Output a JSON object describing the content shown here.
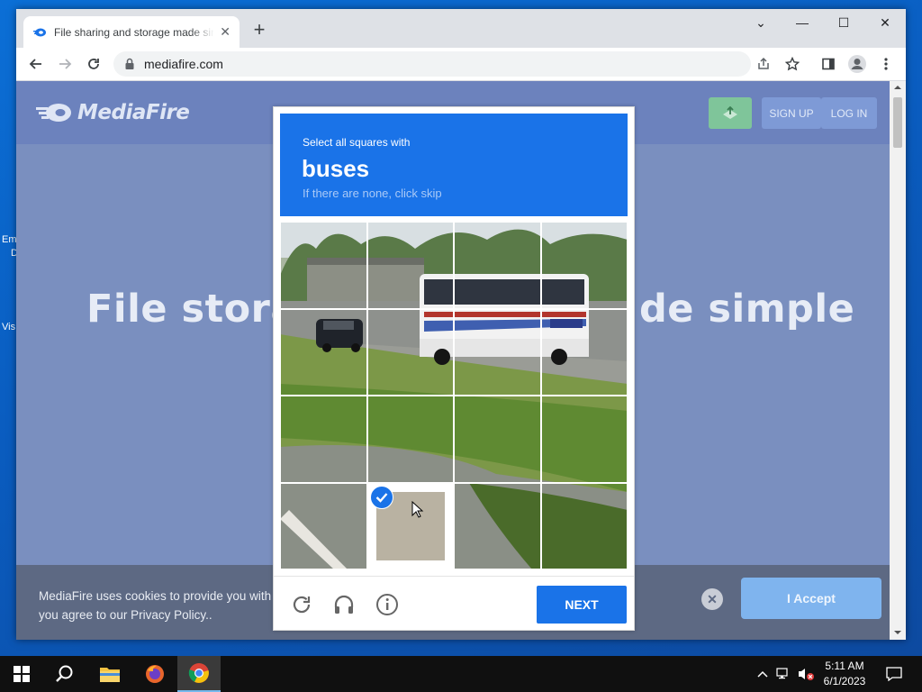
{
  "desktop": {
    "icon_labels": [
      "Em",
      "D",
      "Vis"
    ]
  },
  "browser": {
    "tab": {
      "title": "File sharing and storage made simple",
      "close_glyph": "✕"
    },
    "new_tab_glyph": "+",
    "window_controls": {
      "chevron": "⌄",
      "minimize": "—",
      "maximize": "☐",
      "close": "✕"
    },
    "address": "mediafire.com"
  },
  "page": {
    "logo_text": "MediaFire",
    "signup_label": "SIGN UP",
    "login_label": "LOG IN",
    "hero_text": "File storage made simple",
    "hero_left": "File storag",
    "hero_right": "de simple",
    "cookie_text": "MediaFire uses cookies to provide you with",
    "cookie_text_2": "you agree to our Privacy Policy..",
    "cookie_close_glyph": "✕",
    "accept_label": "I Accept"
  },
  "captcha": {
    "instruction": "Select all squares with",
    "target": "buses",
    "hint": "If there are none, click skip",
    "next_label": "NEXT",
    "grid_rows": 4,
    "grid_cols": 4,
    "selected_cells": [
      13
    ]
  },
  "taskbar": {
    "time": "5:11 AM",
    "date": "6/1/2023"
  },
  "colors": {
    "captcha_blue": "#1a73e8",
    "overlay_page": "#7a8fbf",
    "taskbar": "#101010"
  }
}
